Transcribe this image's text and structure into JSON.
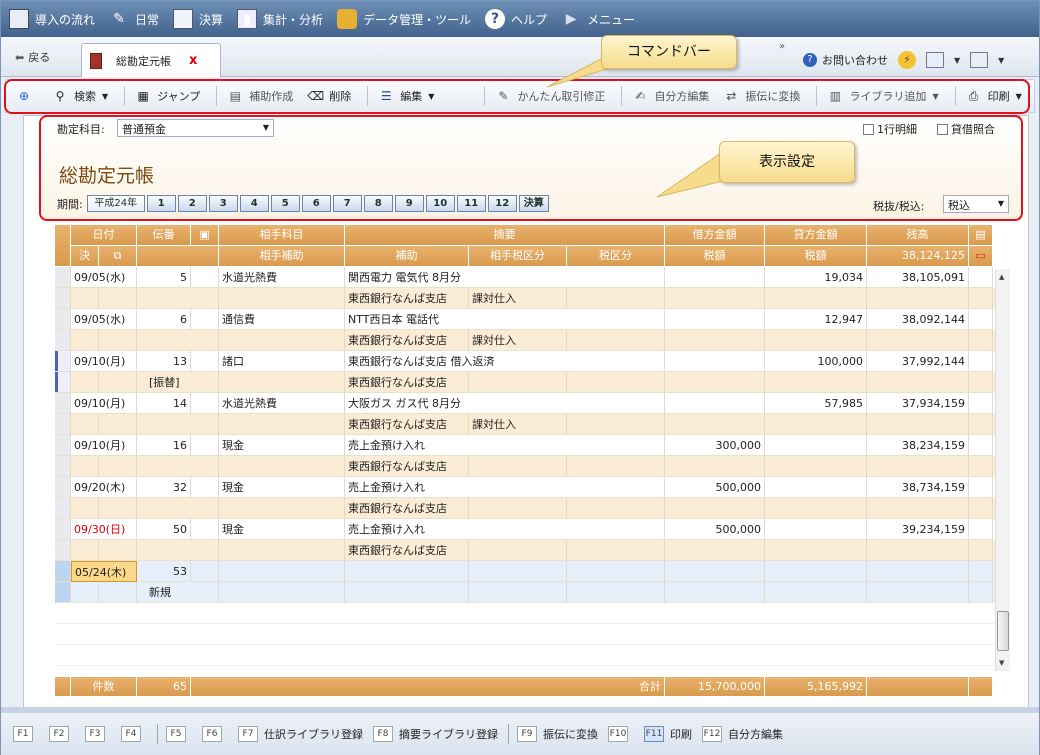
{
  "menu": [
    {
      "label": "導入の流れ",
      "icon": "flow-icon"
    },
    {
      "label": "日常",
      "icon": "pen-icon"
    },
    {
      "label": "決算",
      "icon": "document-icon"
    },
    {
      "label": "集計・分析",
      "icon": "chart-icon"
    },
    {
      "label": "データ管理・ツール",
      "icon": "database-icon"
    },
    {
      "label": "ヘルプ",
      "icon": "help-icon"
    },
    {
      "label": "メニュー",
      "icon": "play-icon"
    }
  ],
  "tabs": {
    "back": "戻る",
    "doc_title": "総勘定元帳",
    "close": "x",
    "more": "»",
    "inquiry": "お問い合わせ"
  },
  "command": {
    "search": "検索",
    "jump": "ジャンプ",
    "assist": "補助作成",
    "delete": "削除",
    "edit": "編集",
    "easy_fix": "かんたん取引修正",
    "split_edit": "自分方編集",
    "to_voucher": "振伝に変換",
    "library_add": "ライブラリ追加",
    "print": "印刷"
  },
  "callouts": {
    "command_bar": "コマンドバー",
    "display_settings": "表示設定"
  },
  "settings": {
    "account_label": "勘定科目:",
    "account_value": "普通預金",
    "one_line": "1行明細",
    "reconcile": "貸借照合",
    "title": "総勘定元帳",
    "period_label": "期間:",
    "period_year": "平成24年",
    "months": [
      "1",
      "2",
      "3",
      "4",
      "5",
      "6",
      "7",
      "8",
      "9",
      "10",
      "11",
      "12",
      "決算"
    ],
    "tax_label": "税抜/税込:",
    "tax_value": "税込"
  },
  "headers": {
    "date": "日付",
    "voucher": "伝番",
    "counter_account": "相手科目",
    "summary": "摘要",
    "debit": "借方金額",
    "credit": "貸方金額",
    "balance": "残高",
    "settle": "決",
    "counter_sub": "相手補助",
    "sub": "補助",
    "counter_tax": "相手税区分",
    "tax_class": "税区分",
    "tax_amount": "税額",
    "tax_amount2": "税額",
    "opening_balance": "38,124,125"
  },
  "rows": [
    {
      "date": "09/05(水)",
      "no": "5",
      "account": "水道光熱費",
      "summary": "関西電力 電気代 8月分",
      "debit": "",
      "credit": "19,034",
      "balance": "38,105,091",
      "sub": "東西銀行なんば支店",
      "ctax": "課対仕入",
      "tag": ""
    },
    {
      "date": "09/05(水)",
      "no": "6",
      "account": "通信費",
      "summary": "NTT西日本 電話代",
      "debit": "",
      "credit": "12,947",
      "balance": "38,092,144",
      "sub": "東西銀行なんば支店",
      "ctax": "課対仕入",
      "tag": ""
    },
    {
      "date": "09/10(月)",
      "no": "13",
      "account": "諸口",
      "summary": "東西銀行なんば支店 借入返済",
      "debit": "",
      "credit": "100,000",
      "balance": "37,992,144",
      "sub": "東西銀行なんば支店",
      "ctax": "",
      "tag": "[振替]"
    },
    {
      "date": "09/10(月)",
      "no": "14",
      "account": "水道光熱費",
      "summary": "大阪ガス ガス代 8月分",
      "debit": "",
      "credit": "57,985",
      "balance": "37,934,159",
      "sub": "東西銀行なんば支店",
      "ctax": "課対仕入",
      "tag": ""
    },
    {
      "date": "09/10(月)",
      "no": "16",
      "account": "現金",
      "summary": "売上金預け入れ",
      "debit": "300,000",
      "credit": "",
      "balance": "38,234,159",
      "sub": "東西銀行なんば支店",
      "ctax": "",
      "tag": ""
    },
    {
      "date": "09/20(木)",
      "no": "32",
      "account": "現金",
      "summary": "売上金預け入れ",
      "debit": "500,000",
      "credit": "",
      "balance": "38,734,159",
      "sub": "東西銀行なんば支店",
      "ctax": "",
      "tag": ""
    },
    {
      "date": "09/30(日)",
      "no": "50",
      "account": "現金",
      "summary": "売上金預け入れ",
      "debit": "500,000",
      "credit": "",
      "balance": "39,234,159",
      "sub": "東西銀行なんば支店",
      "ctax": "",
      "tag": ""
    }
  ],
  "new_row": {
    "date": "05/24(木)",
    "no": "53",
    "tag": "新規"
  },
  "footer": {
    "count_label": "件数",
    "count": "65",
    "total_label": "合計",
    "debit_total": "15,700,000",
    "credit_total": "5,165,992"
  },
  "fkeys": [
    {
      "key": "F1",
      "label": ""
    },
    {
      "key": "F2",
      "label": ""
    },
    {
      "key": "F3",
      "label": ""
    },
    {
      "key": "F4",
      "label": ""
    },
    {
      "key": "F5",
      "label": ""
    },
    {
      "key": "F6",
      "label": ""
    },
    {
      "key": "F7",
      "label": "仕訳ライブラリ登録"
    },
    {
      "key": "F8",
      "label": "摘要ライブラリ登録"
    },
    {
      "key": "F9",
      "label": "振伝に変換"
    },
    {
      "key": "F10",
      "label": ""
    },
    {
      "key": "F11",
      "label": "印刷"
    },
    {
      "key": "F12",
      "label": "自分方編集"
    }
  ]
}
